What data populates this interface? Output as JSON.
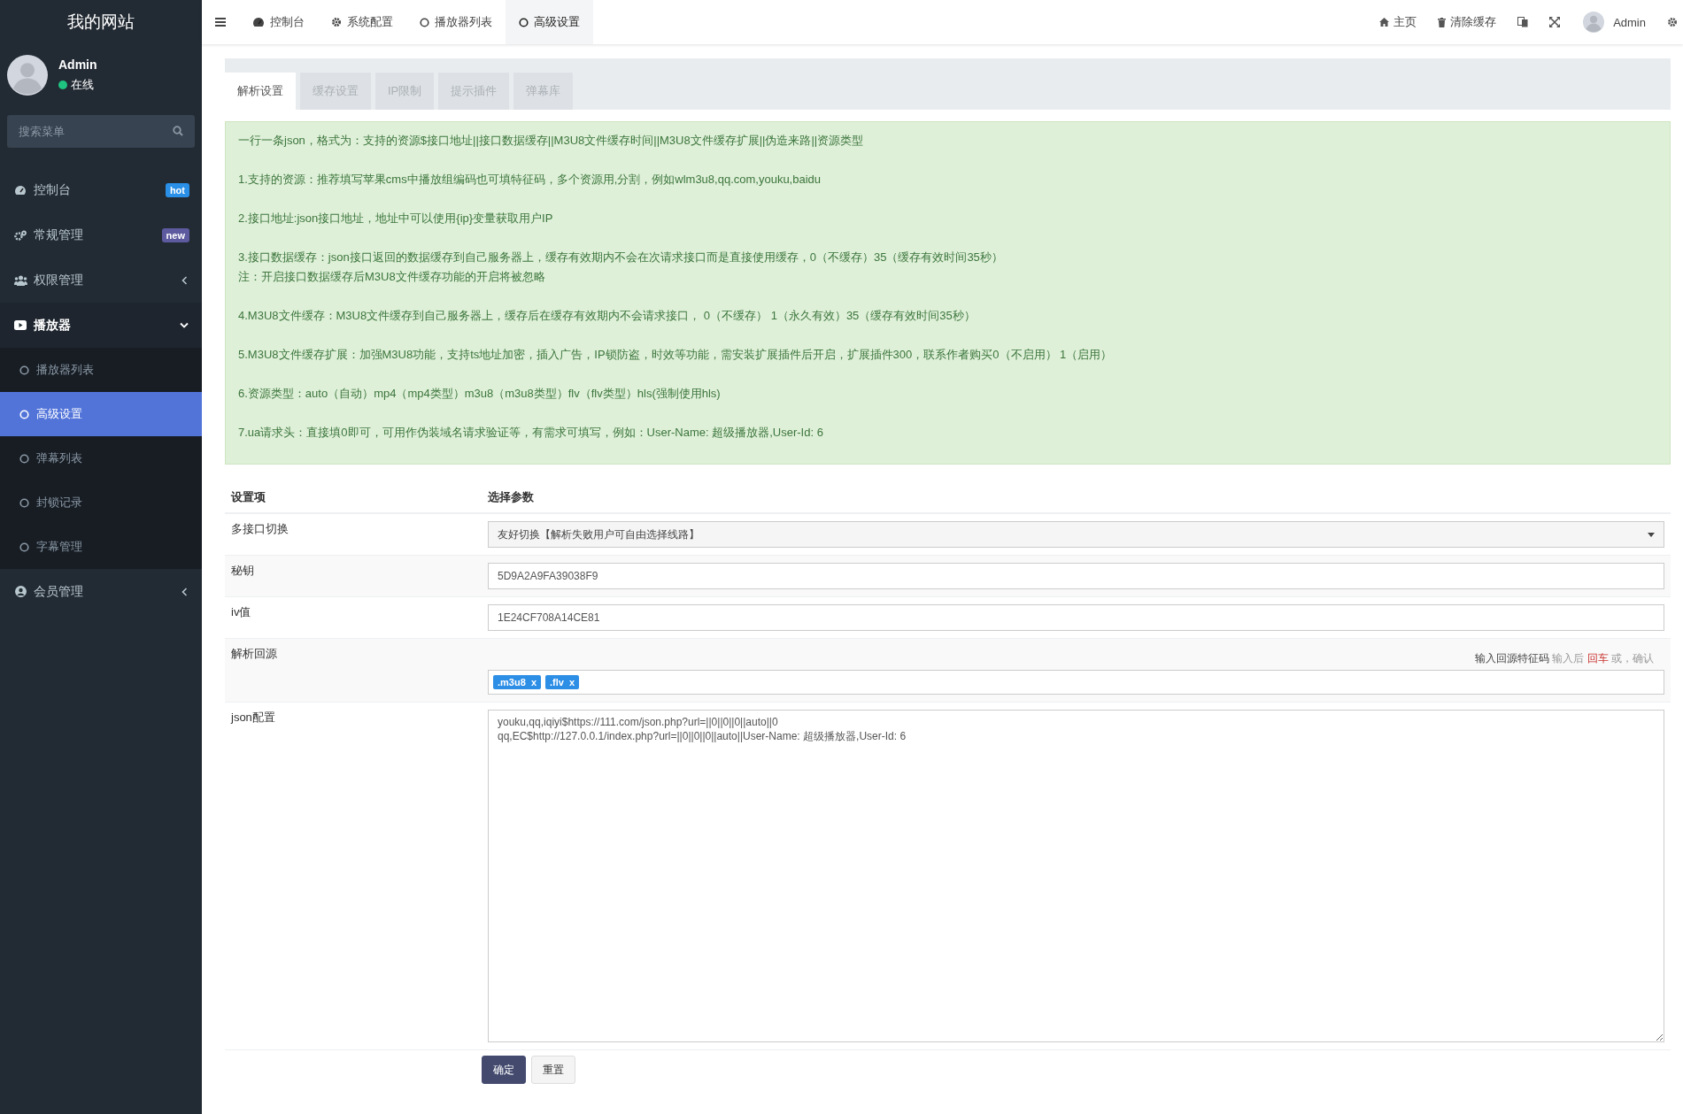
{
  "sidebar": {
    "logo": "我的网站",
    "user": {
      "name": "Admin",
      "status": {
        "text": "在线",
        "color": "#1ec47f"
      }
    },
    "search": {
      "placeholder": "搜索菜单"
    },
    "items": [
      {
        "label": "控制台",
        "badge": {
          "text": "hot",
          "color": "#2a8fe6"
        }
      },
      {
        "label": "常规管理",
        "badge": {
          "text": "new",
          "color": "#5d5a9f"
        }
      },
      {
        "label": "权限管理",
        "expanded": false
      },
      {
        "label": "播放器",
        "expanded": true,
        "children": [
          {
            "label": "播放器列表",
            "selected": false
          },
          {
            "label": "高级设置",
            "selected": true
          },
          {
            "label": "弹幕列表",
            "selected": false
          },
          {
            "label": "封锁记录",
            "selected": false
          },
          {
            "label": "字幕管理",
            "selected": false
          }
        ]
      },
      {
        "label": "会员管理",
        "expanded": false
      }
    ]
  },
  "topbar": {
    "tabs": [
      {
        "label": "控制台",
        "selected": false
      },
      {
        "label": "系统配置",
        "selected": false
      },
      {
        "label": "播放器列表",
        "selected": false
      },
      {
        "label": "高级设置",
        "selected": true
      }
    ],
    "links": [
      "主页",
      "清除缓存"
    ],
    "user": "Admin"
  },
  "settings_tabs": [
    {
      "label": "解析设置",
      "selected": true
    },
    {
      "label": "缓存设置",
      "selected": false
    },
    {
      "label": "IP限制",
      "selected": false
    },
    {
      "label": "提示插件",
      "selected": false
    },
    {
      "label": "弹幕库",
      "selected": false
    }
  ],
  "notice": [
    [
      "一行一条json，格式为：支持的资源$接口地址||接口数据缓存||M3U8文件缓存时间||M3U8文件缓存扩展||伪造来路||资源类型"
    ],
    [
      "1.支持的资源：推荐填写苹果cms中播放组编码也可填特征码，多个资源用,分割，例如wlm3u8,qq.com,youku,baidu"
    ],
    [
      "2.接口地址:json接口地址，地址中可以使用{ip}变量获取用户IP"
    ],
    [
      "3.接口数据缓存：json接口返回的数据缓存到自己服务器上，缓存有效期内不会在次请求接口而是直接使用缓存，0（不缓存）35（缓存有效时间35秒）",
      "注：开启接口数据缓存后M3U8文件缓存功能的开启将被忽略"
    ],
    [
      "4.M3U8文件缓存：M3U8文件缓存到自己服务器上，缓存后在缓存有效期内不会请求接口， 0（不缓存） 1（永久有效）35（缓存有效时间35秒）"
    ],
    [
      "5.M3U8文件缓存扩展：加强M3U8功能，支持ts地址加密，插入广告，IP锁防盗，时效等功能，需安装扩展插件后开启，扩展插件300，联系作者购买0（不启用） 1（启用）"
    ],
    [
      "6.资源类型：auto（自动）mp4（mp4类型）m3u8（m3u8类型）flv（flv类型）hls(强制使用hls)"
    ],
    [
      "7.ua请求头：直接填0即可，可用作伪装域名请求验证等，有需求可填写，例如：User-Name: 超级播放器,User-Id: 6"
    ]
  ],
  "table": {
    "columns": [
      "设置项",
      "选择参数"
    ],
    "rows": [
      {
        "label": "多接口切换",
        "kind": "select",
        "value": "友好切换【解析失败用户可自由选择线路】"
      },
      {
        "label": "秘钥",
        "kind": "input",
        "value": "5D9A2A9FA39038F9"
      },
      {
        "label": "iv值",
        "kind": "input",
        "value": "1E24CF708A14CE81"
      },
      {
        "label": "解析回源",
        "kind": "tags",
        "tags": [
          {
            "label": ".m3u8",
            "remove": "x"
          },
          {
            "label": ".flv",
            "remove": "x"
          }
        ],
        "hint": [
          {
            "text": "输入回源特征码",
            "kind": "strong"
          },
          {
            "text": "输入后",
            "kind": "muted"
          },
          {
            "text": "回车",
            "kind": "danger"
          },
          {
            "text": "或，确认",
            "kind": "muted"
          }
        ]
      },
      {
        "label": "json配置",
        "kind": "textarea",
        "value": "youku,qq,iqiyi$https://111.com/json.php?url=||0||0||0||auto||0\nqq,EC$http://127.0.0.1/index.php?url=||0||0||0||auto||User-Name: 超级播放器,User-Id: 6"
      }
    ]
  },
  "buttons": [
    {
      "label": "确定",
      "kind": "primary"
    },
    {
      "label": "重置",
      "kind": "default"
    }
  ]
}
